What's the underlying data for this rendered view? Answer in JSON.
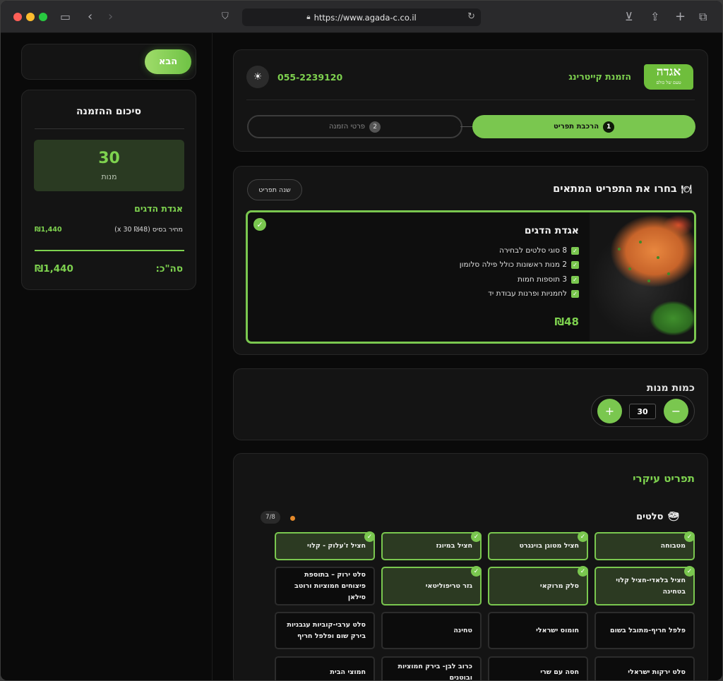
{
  "browser": {
    "url": "https://www.agada-c.co.il"
  },
  "header": {
    "logo_big": "אגדה",
    "logo_small": "טעם של כולם",
    "brand_title": "הזמנת קייטרינג",
    "phone": "055-2239120",
    "theme_icon": "sun-icon",
    "steps": [
      {
        "num": "1",
        "label": "הרכבת תפריט",
        "active": true
      },
      {
        "num": "2",
        "label": "פרטי הזמנה",
        "active": false
      }
    ]
  },
  "sidebar": {
    "next_label": "הבא",
    "summary_title": "סיכום ההזמנה",
    "qty_value": "30",
    "qty_label": "מנות",
    "package_name": "אגדת הדגים",
    "base_label": "מחיר בסיס (₪48 x 30)",
    "base_value": "₪1,440",
    "total_label": "סה\"כ:",
    "total_value": "₪1,440"
  },
  "menu_select": {
    "title": "בחרו את התפריט המתאים",
    "change_label": "שנה תפריט",
    "package": {
      "name": "אגדת הדגים",
      "features": [
        "8 סוגי סלטים לבחירה",
        "2 מנות ראשונות כולל פילה סלומון",
        "3 תוספות חמות",
        "לחמניות ופרנות עבודת יד"
      ],
      "price": "₪48"
    }
  },
  "quantity": {
    "title": "כמות מנות",
    "value": "30",
    "plus": "+",
    "minus": "−"
  },
  "main_menu": {
    "title": "תפריט עיקרי",
    "section_title": "סלטים",
    "section_count": "7/8",
    "items": [
      {
        "label": "מטבוחה",
        "selected": true
      },
      {
        "label": "חציל מטוגן בוינגרט",
        "selected": true
      },
      {
        "label": "חציל במיונז",
        "selected": true
      },
      {
        "label": "חציל ז'עלוק - קלוי",
        "selected": true
      },
      {
        "label": "חציל בלאדי-חציל קלוי בטחינה",
        "selected": true
      },
      {
        "label": "סלק מרוקאי",
        "selected": true
      },
      {
        "label": "גזר טריפוליטאי",
        "selected": true
      },
      {
        "label": "סלט ירוק – בתוספת פיצוחים חמוציות ורוטב סילאן",
        "selected": false
      },
      {
        "label": "פלפל חריף-מתובל בשום",
        "selected": false
      },
      {
        "label": "חומוס ישראלי",
        "selected": false
      },
      {
        "label": "טחינה",
        "selected": false
      },
      {
        "label": "סלט ערבי-קוביות עגבניות בירק שום ופלפל חריף",
        "selected": false
      },
      {
        "label": "סלט ירקות ישראלי",
        "selected": false
      },
      {
        "label": "חסה עם שרי",
        "selected": false
      },
      {
        "label": "כרוב לבן- בירק חמוציות ובוטנים",
        "selected": false
      },
      {
        "label": "חמוצי הבית",
        "selected": false
      }
    ]
  }
}
